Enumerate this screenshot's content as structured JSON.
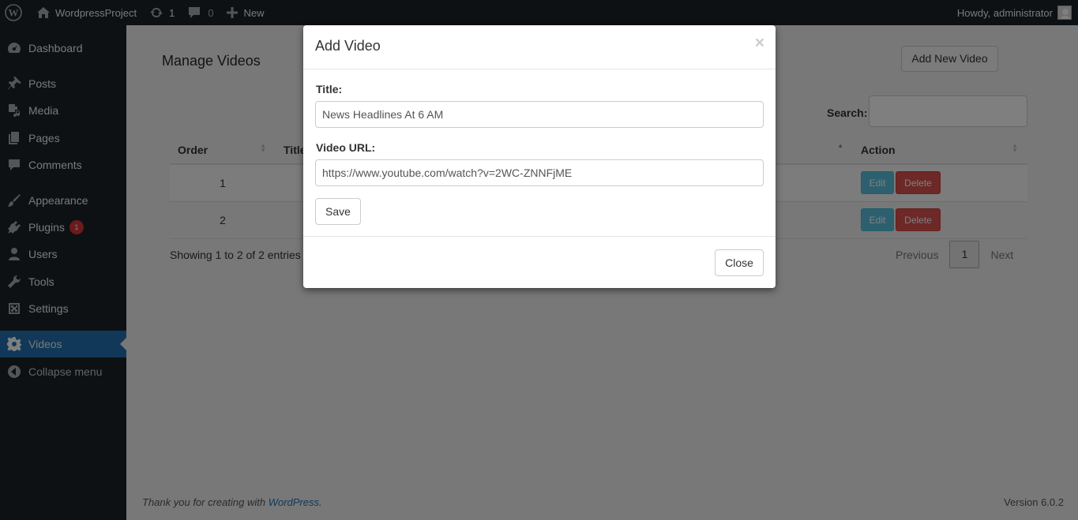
{
  "adminbar": {
    "site_name": "WordpressProject",
    "updates_count": "1",
    "comments_count": "0",
    "new_label": "New",
    "howdy": "Howdy, administrator"
  },
  "sidebar": {
    "items": [
      {
        "label": "Dashboard",
        "icon": "dashboard-icon"
      },
      {
        "label": "Posts",
        "icon": "pin-icon"
      },
      {
        "label": "Media",
        "icon": "media-icon"
      },
      {
        "label": "Pages",
        "icon": "pages-icon"
      },
      {
        "label": "Comments",
        "icon": "comment-icon"
      },
      {
        "label": "Appearance",
        "icon": "brush-icon"
      },
      {
        "label": "Plugins",
        "icon": "plugin-icon",
        "badge": "1"
      },
      {
        "label": "Users",
        "icon": "user-icon"
      },
      {
        "label": "Tools",
        "icon": "wrench-icon"
      },
      {
        "label": "Settings",
        "icon": "settings-icon"
      },
      {
        "label": "Videos",
        "icon": "gear-icon",
        "active": true
      },
      {
        "label": "Collapse menu",
        "icon": "collapse-icon"
      }
    ]
  },
  "page": {
    "title": "Manage Videos",
    "add_new_label": "Add New Video",
    "search_label": "Search:",
    "table": {
      "columns": [
        "Order",
        "Title",
        "Action"
      ],
      "rows": [
        {
          "order": "1",
          "edit": "Edit",
          "delete": "Delete"
        },
        {
          "order": "2",
          "edit": "Edit",
          "delete": "Delete"
        }
      ]
    },
    "info": "Showing 1 to 2 of 2 entries",
    "pager": {
      "previous": "Previous",
      "current": "1",
      "next": "Next"
    }
  },
  "footer": {
    "thanks_prefix": "Thank you for creating with ",
    "thanks_link": "WordPress",
    "thanks_suffix": ".",
    "version": "Version 6.0.2"
  },
  "modal": {
    "title": "Add Video",
    "close_x": "×",
    "title_label": "Title:",
    "title_value": "News Headlines At 6 AM",
    "url_label": "Video URL:",
    "url_value": "https://www.youtube.com/watch?v=2WC-ZNNFjME",
    "save_label": "Save",
    "close_label": "Close"
  },
  "colors": {
    "admin_dark": "#1d2327",
    "active_blue": "#2271b1",
    "edit_blue": "#5bc0de",
    "delete_red": "#d9534f",
    "badge_red": "#d63638"
  }
}
